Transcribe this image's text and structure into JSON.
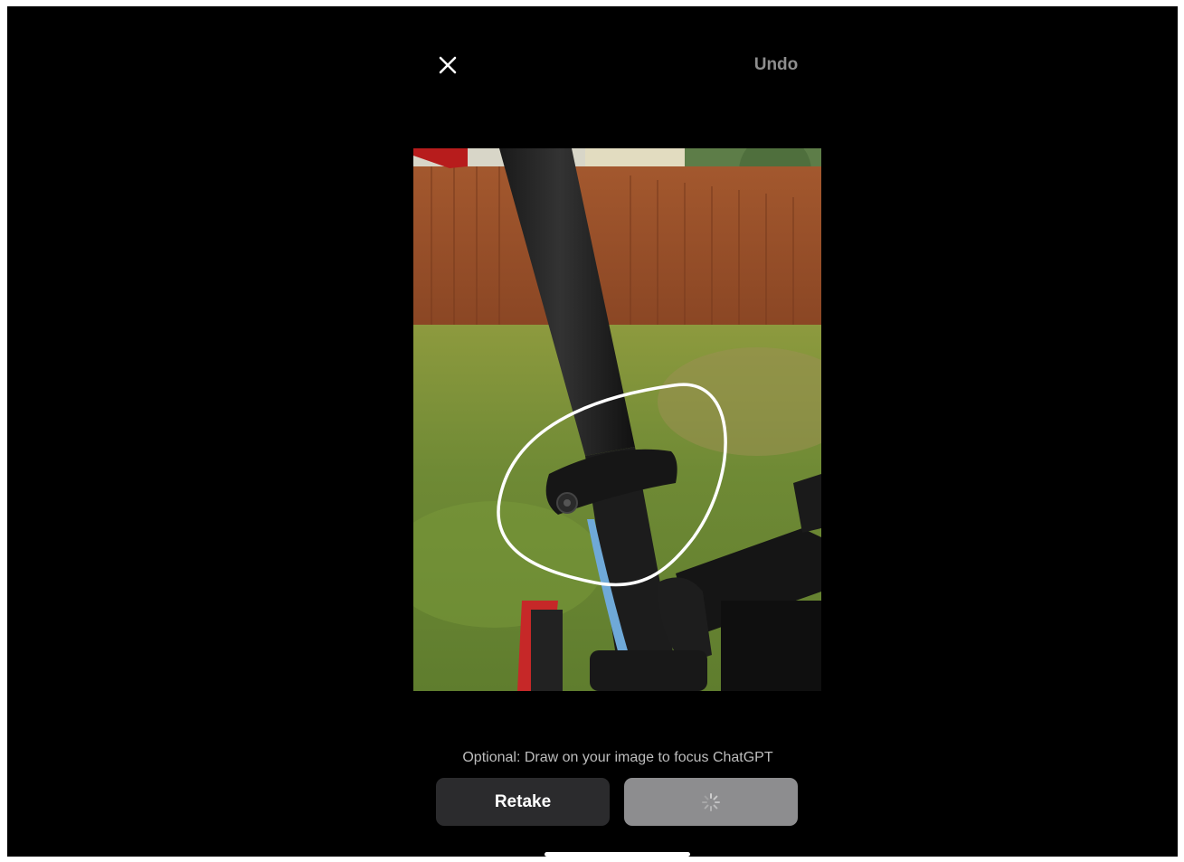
{
  "toolbar": {
    "close_icon": "close-icon",
    "undo_label": "Undo"
  },
  "image": {
    "subject": "photo-of-bike-seatpost-clamp",
    "annotation": "hand-drawn-white-circle"
  },
  "footer": {
    "hint": "Optional: Draw on your image to focus ChatGPT",
    "retake_label": "Retake",
    "loading_icon": "spinner-icon"
  },
  "colors": {
    "background": "#000000",
    "undo_text": "#8e8e8e",
    "retake_bg": "#2b2b2d",
    "continue_bg_disabled": "#8d8d8f"
  }
}
